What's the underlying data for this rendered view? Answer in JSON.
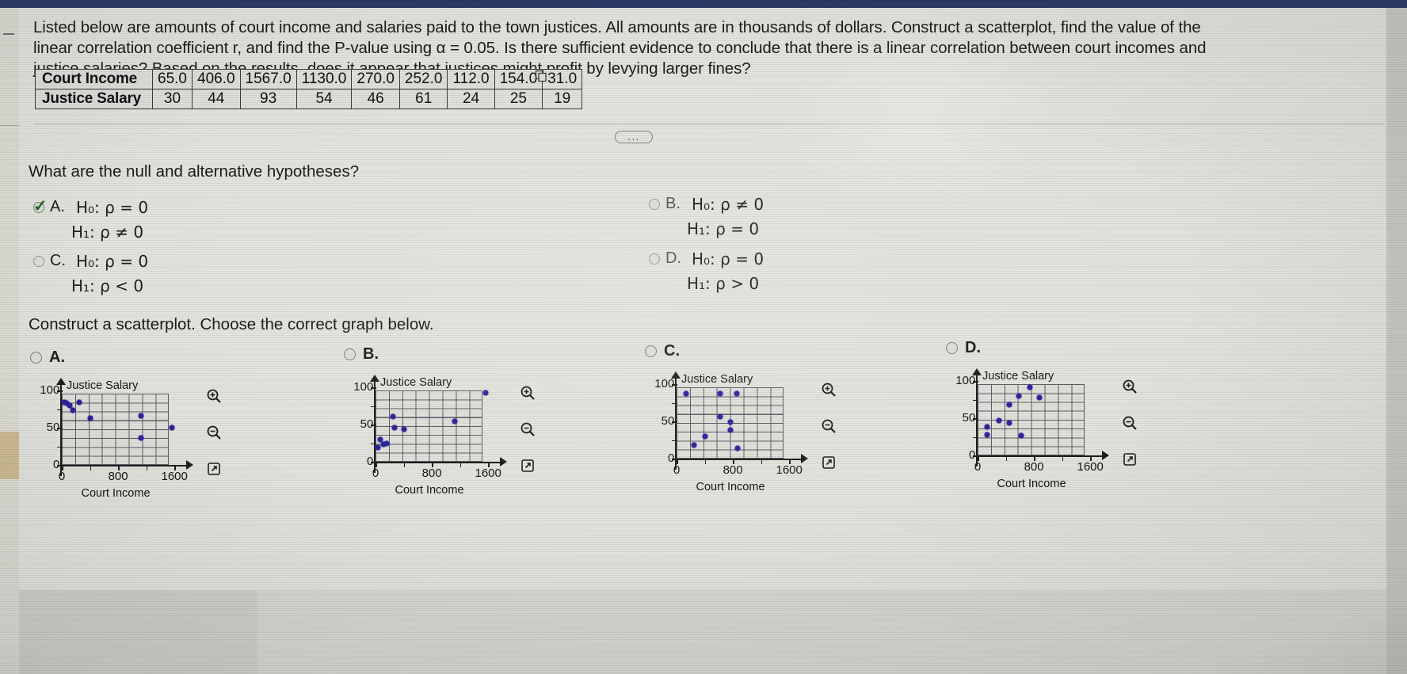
{
  "problem": {
    "text": "Listed below are amounts of court income and salaries paid to the town justices. All amounts are in thousands of dollars. Construct a scatterplot, find the value of the linear correlation coefficient r, and find the P-value using α = 0.05. Is there sufficient evidence to conclude that there is a linear correlation between court incomes and justice salaries? Based on the results, does it appear that justices might profit by levying larger fines?"
  },
  "table": {
    "rows": [
      {
        "label": "Court Income",
        "values": [
          "65.0",
          "406.0",
          "1567.0",
          "1130.0",
          "270.0",
          "252.0",
          "112.0",
          "154.0",
          "31.0"
        ]
      },
      {
        "label": "Justice Salary",
        "values": [
          "30",
          "44",
          "93",
          "54",
          "46",
          "61",
          "24",
          "25",
          "19"
        ]
      }
    ],
    "copy_icon": "copy-icon"
  },
  "ellipsis": "...",
  "question1": {
    "prompt": "What are the null and alternative hypotheses?",
    "options": [
      {
        "key": "A.",
        "h0": "H₀: ρ = 0",
        "h1": "H₁: ρ ≠ 0",
        "selected": true
      },
      {
        "key": "B.",
        "h0": "H₀: ρ ≠ 0",
        "h1": "H₁: ρ = 0",
        "selected": false
      },
      {
        "key": "C.",
        "h0": "H₀: ρ = 0",
        "h1": "H₁: ρ < 0",
        "selected": false
      },
      {
        "key": "D.",
        "h0": "H₀: ρ = 0",
        "h1": "H₁: ρ > 0",
        "selected": false
      }
    ]
  },
  "question2": {
    "prompt": "Construct a scatterplot. Choose the correct graph below.",
    "choices": [
      {
        "key": "A.",
        "selected": false
      },
      {
        "key": "B.",
        "selected": false
      },
      {
        "key": "C.",
        "selected": false
      },
      {
        "key": "D.",
        "selected": false
      }
    ],
    "tools": [
      "zoom-in-icon",
      "zoom-out-icon",
      "expand-icon"
    ]
  },
  "chart_data": [
    {
      "id": "A",
      "type": "scatter",
      "title": "",
      "xlabel": "Court Income",
      "ylabel": "Justice Salary",
      "xlim": [
        0,
        1800
      ],
      "ylim": [
        0,
        110
      ],
      "xticks": [
        0,
        800,
        1600
      ],
      "yticks": [
        0,
        50,
        100
      ],
      "grid": true,
      "points": [
        {
          "x": 31,
          "y": 84
        },
        {
          "x": 65,
          "y": 83
        },
        {
          "x": 112,
          "y": 80
        },
        {
          "x": 154,
          "y": 74
        },
        {
          "x": 252,
          "y": 84
        },
        {
          "x": 406,
          "y": 63
        },
        {
          "x": 1130,
          "y": 66
        },
        {
          "x": 1567,
          "y": 50
        },
        {
          "x": 1130,
          "y": 36
        }
      ]
    },
    {
      "id": "B",
      "type": "scatter",
      "title": "",
      "xlabel": "Court Income",
      "ylabel": "Justice Salary",
      "xlim": [
        0,
        1800
      ],
      "ylim": [
        0,
        110
      ],
      "xticks": [
        0,
        800,
        1600
      ],
      "yticks": [
        0,
        50,
        100
      ],
      "grid": true,
      "points": [
        {
          "x": 31,
          "y": 19
        },
        {
          "x": 65,
          "y": 30
        },
        {
          "x": 112,
          "y": 24
        },
        {
          "x": 154,
          "y": 25
        },
        {
          "x": 252,
          "y": 61
        },
        {
          "x": 270,
          "y": 46
        },
        {
          "x": 406,
          "y": 44
        },
        {
          "x": 1130,
          "y": 54
        },
        {
          "x": 1567,
          "y": 93
        }
      ]
    },
    {
      "id": "C",
      "type": "scatter",
      "title": "",
      "xlabel": "Court Income",
      "ylabel": "Justice Salary",
      "xlim": [
        0,
        1800
      ],
      "ylim": [
        0,
        110
      ],
      "xticks": [
        0,
        800,
        1600
      ],
      "yticks": [
        0,
        50,
        100
      ],
      "grid": true,
      "points": [
        {
          "x": 140,
          "y": 87
        },
        {
          "x": 620,
          "y": 87
        },
        {
          "x": 860,
          "y": 87
        },
        {
          "x": 620,
          "y": 57
        },
        {
          "x": 760,
          "y": 49
        },
        {
          "x": 760,
          "y": 38
        },
        {
          "x": 400,
          "y": 30
        },
        {
          "x": 250,
          "y": 18
        },
        {
          "x": 870,
          "y": 14
        }
      ]
    },
    {
      "id": "D",
      "type": "scatter",
      "title": "",
      "xlabel": "Court Income",
      "ylabel": "Justice Salary",
      "xlim": [
        0,
        1800
      ],
      "ylim": [
        0,
        110
      ],
      "xticks": [
        0,
        800,
        1600
      ],
      "yticks": [
        0,
        50,
        100
      ],
      "grid": true,
      "points": [
        {
          "x": 740,
          "y": 92
        },
        {
          "x": 580,
          "y": 80
        },
        {
          "x": 880,
          "y": 78
        },
        {
          "x": 450,
          "y": 68
        },
        {
          "x": 300,
          "y": 47
        },
        {
          "x": 450,
          "y": 44
        },
        {
          "x": 140,
          "y": 38
        },
        {
          "x": 140,
          "y": 28
        },
        {
          "x": 620,
          "y": 27
        }
      ]
    }
  ],
  "colors": {
    "point": "#2b239c",
    "check": "#1f6b22",
    "topbar": "#2b3a66",
    "page": "#e3e3dd"
  }
}
